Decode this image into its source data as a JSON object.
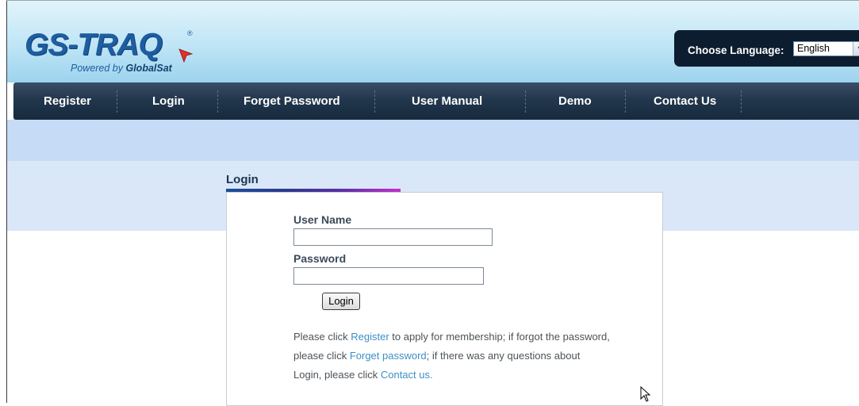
{
  "header": {
    "logo_text": "GS-TRAQ",
    "logo_registered": "®",
    "logo_tagline_prefix": "Powered by ",
    "logo_tagline_brand": "GlobalSat",
    "language_label": "Choose Language:",
    "language_selected": "English",
    "language_dropdown_arrow": "▾"
  },
  "nav": {
    "items": [
      {
        "label": "Register"
      },
      {
        "label": "Login"
      },
      {
        "label": "Forget Password"
      },
      {
        "label": "User Manual"
      },
      {
        "label": "Demo"
      },
      {
        "label": "Contact Us"
      }
    ]
  },
  "login": {
    "heading": "Login",
    "username_label": "User Name",
    "username_value": "",
    "password_label": "Password",
    "password_value": "",
    "submit_label": "Login",
    "info": {
      "part1": "Please click ",
      "link_register": "Register",
      "part2": " to apply for membership; if forgot the password, please click ",
      "link_forget": "Forget password",
      "part3": "; if there was any questions about Login, please click ",
      "link_contact": "Contact us."
    }
  },
  "colors": {
    "nav_background": "#22374d",
    "link": "#3d8fc7",
    "header_gradient_bottom": "#9dd3ee",
    "logo_blue": "#1e5d9f",
    "logo_arrow_red": "#e2302b"
  },
  "icons": {
    "logo_arrow": "red-pointer-arrow-icon",
    "mouse_cursor": "mouse-pointer-icon"
  }
}
